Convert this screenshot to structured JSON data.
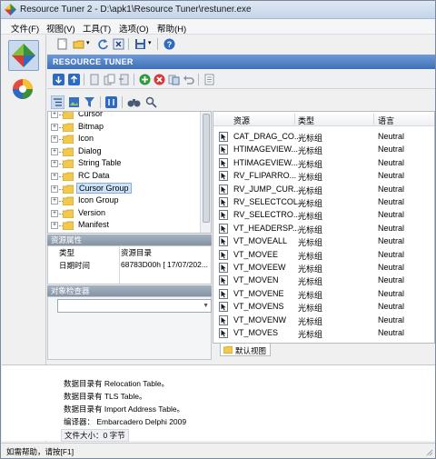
{
  "window": {
    "title": "Resource Tuner 2 - D:\\apk1\\Resource Tuner\\restuner.exe"
  },
  "menu": [
    "文件(F)",
    "视图(V)",
    "工具(T)",
    "选项(O)",
    "帮助(H)"
  ],
  "banner": {
    "label": "RESOURCE TUNER"
  },
  "tree": {
    "items": [
      {
        "label": "Cursor",
        "selected": false
      },
      {
        "label": "Bitmap",
        "selected": false
      },
      {
        "label": "Icon",
        "selected": false
      },
      {
        "label": "Dialog",
        "selected": false
      },
      {
        "label": "String Table",
        "selected": false
      },
      {
        "label": "RC Data",
        "selected": false
      },
      {
        "label": "Cursor Group",
        "selected": true
      },
      {
        "label": "Icon Group",
        "selected": false
      },
      {
        "label": "Version",
        "selected": false
      },
      {
        "label": "Manifest",
        "selected": false
      }
    ]
  },
  "properties": {
    "title": "资源属性",
    "rows": [
      {
        "name": "类型",
        "value": "资源目录"
      },
      {
        "name": "日期时间",
        "value": "68783D00h  [ 17/07/202..."
      }
    ]
  },
  "inspector": {
    "title": "对象检查器",
    "value": ""
  },
  "list": {
    "columns": [
      "资源",
      "类型",
      "语言"
    ],
    "rows": [
      {
        "name": "CAT_DRAG_CO...",
        "type": "光标组",
        "lang": "Neutral"
      },
      {
        "name": "HTIMAGEVIEW...",
        "type": "光标组",
        "lang": "Neutral"
      },
      {
        "name": "HTIMAGEVIEW...",
        "type": "光标组",
        "lang": "Neutral"
      },
      {
        "name": "RV_FLIPARRO...",
        "type": "光标组",
        "lang": "Neutral"
      },
      {
        "name": "RV_JUMP_CUR...",
        "type": "光标组",
        "lang": "Neutral"
      },
      {
        "name": "RV_SELECTCOL...",
        "type": "光标组",
        "lang": "Neutral"
      },
      {
        "name": "RV_SELECTRO...",
        "type": "光标组",
        "lang": "Neutral"
      },
      {
        "name": "VT_HEADERSP...",
        "type": "光标组",
        "lang": "Neutral"
      },
      {
        "name": "VT_MOVEALL",
        "type": "光标组",
        "lang": "Neutral"
      },
      {
        "name": "VT_MOVEE",
        "type": "光标组",
        "lang": "Neutral"
      },
      {
        "name": "VT_MOVEEW",
        "type": "光标组",
        "lang": "Neutral"
      },
      {
        "name": "VT_MOVEN",
        "type": "光标组",
        "lang": "Neutral"
      },
      {
        "name": "VT_MOVENE",
        "type": "光标组",
        "lang": "Neutral"
      },
      {
        "name": "VT_MOVENS",
        "type": "光标组",
        "lang": "Neutral"
      },
      {
        "name": "VT_MOVENW",
        "type": "光标组",
        "lang": "Neutral"
      },
      {
        "name": "VT_MOVES",
        "type": "光标组",
        "lang": "Neutral"
      }
    ]
  },
  "tabs": {
    "default_view": "默认视图"
  },
  "log": {
    "lines": [
      "数据目录有 Relocation Table。",
      "数据目录有 TLS Table。",
      "数据目录有 Import Address Table。",
      "编译器：  Embarcadero Delphi 2009"
    ],
    "file_size": "文件大小：0 字节"
  },
  "status": {
    "text": "如需帮助，请按[F1]"
  },
  "colors": {
    "accent": "#4a7cc4",
    "selection": "#cde3fb",
    "folder": "#f2c94c"
  }
}
